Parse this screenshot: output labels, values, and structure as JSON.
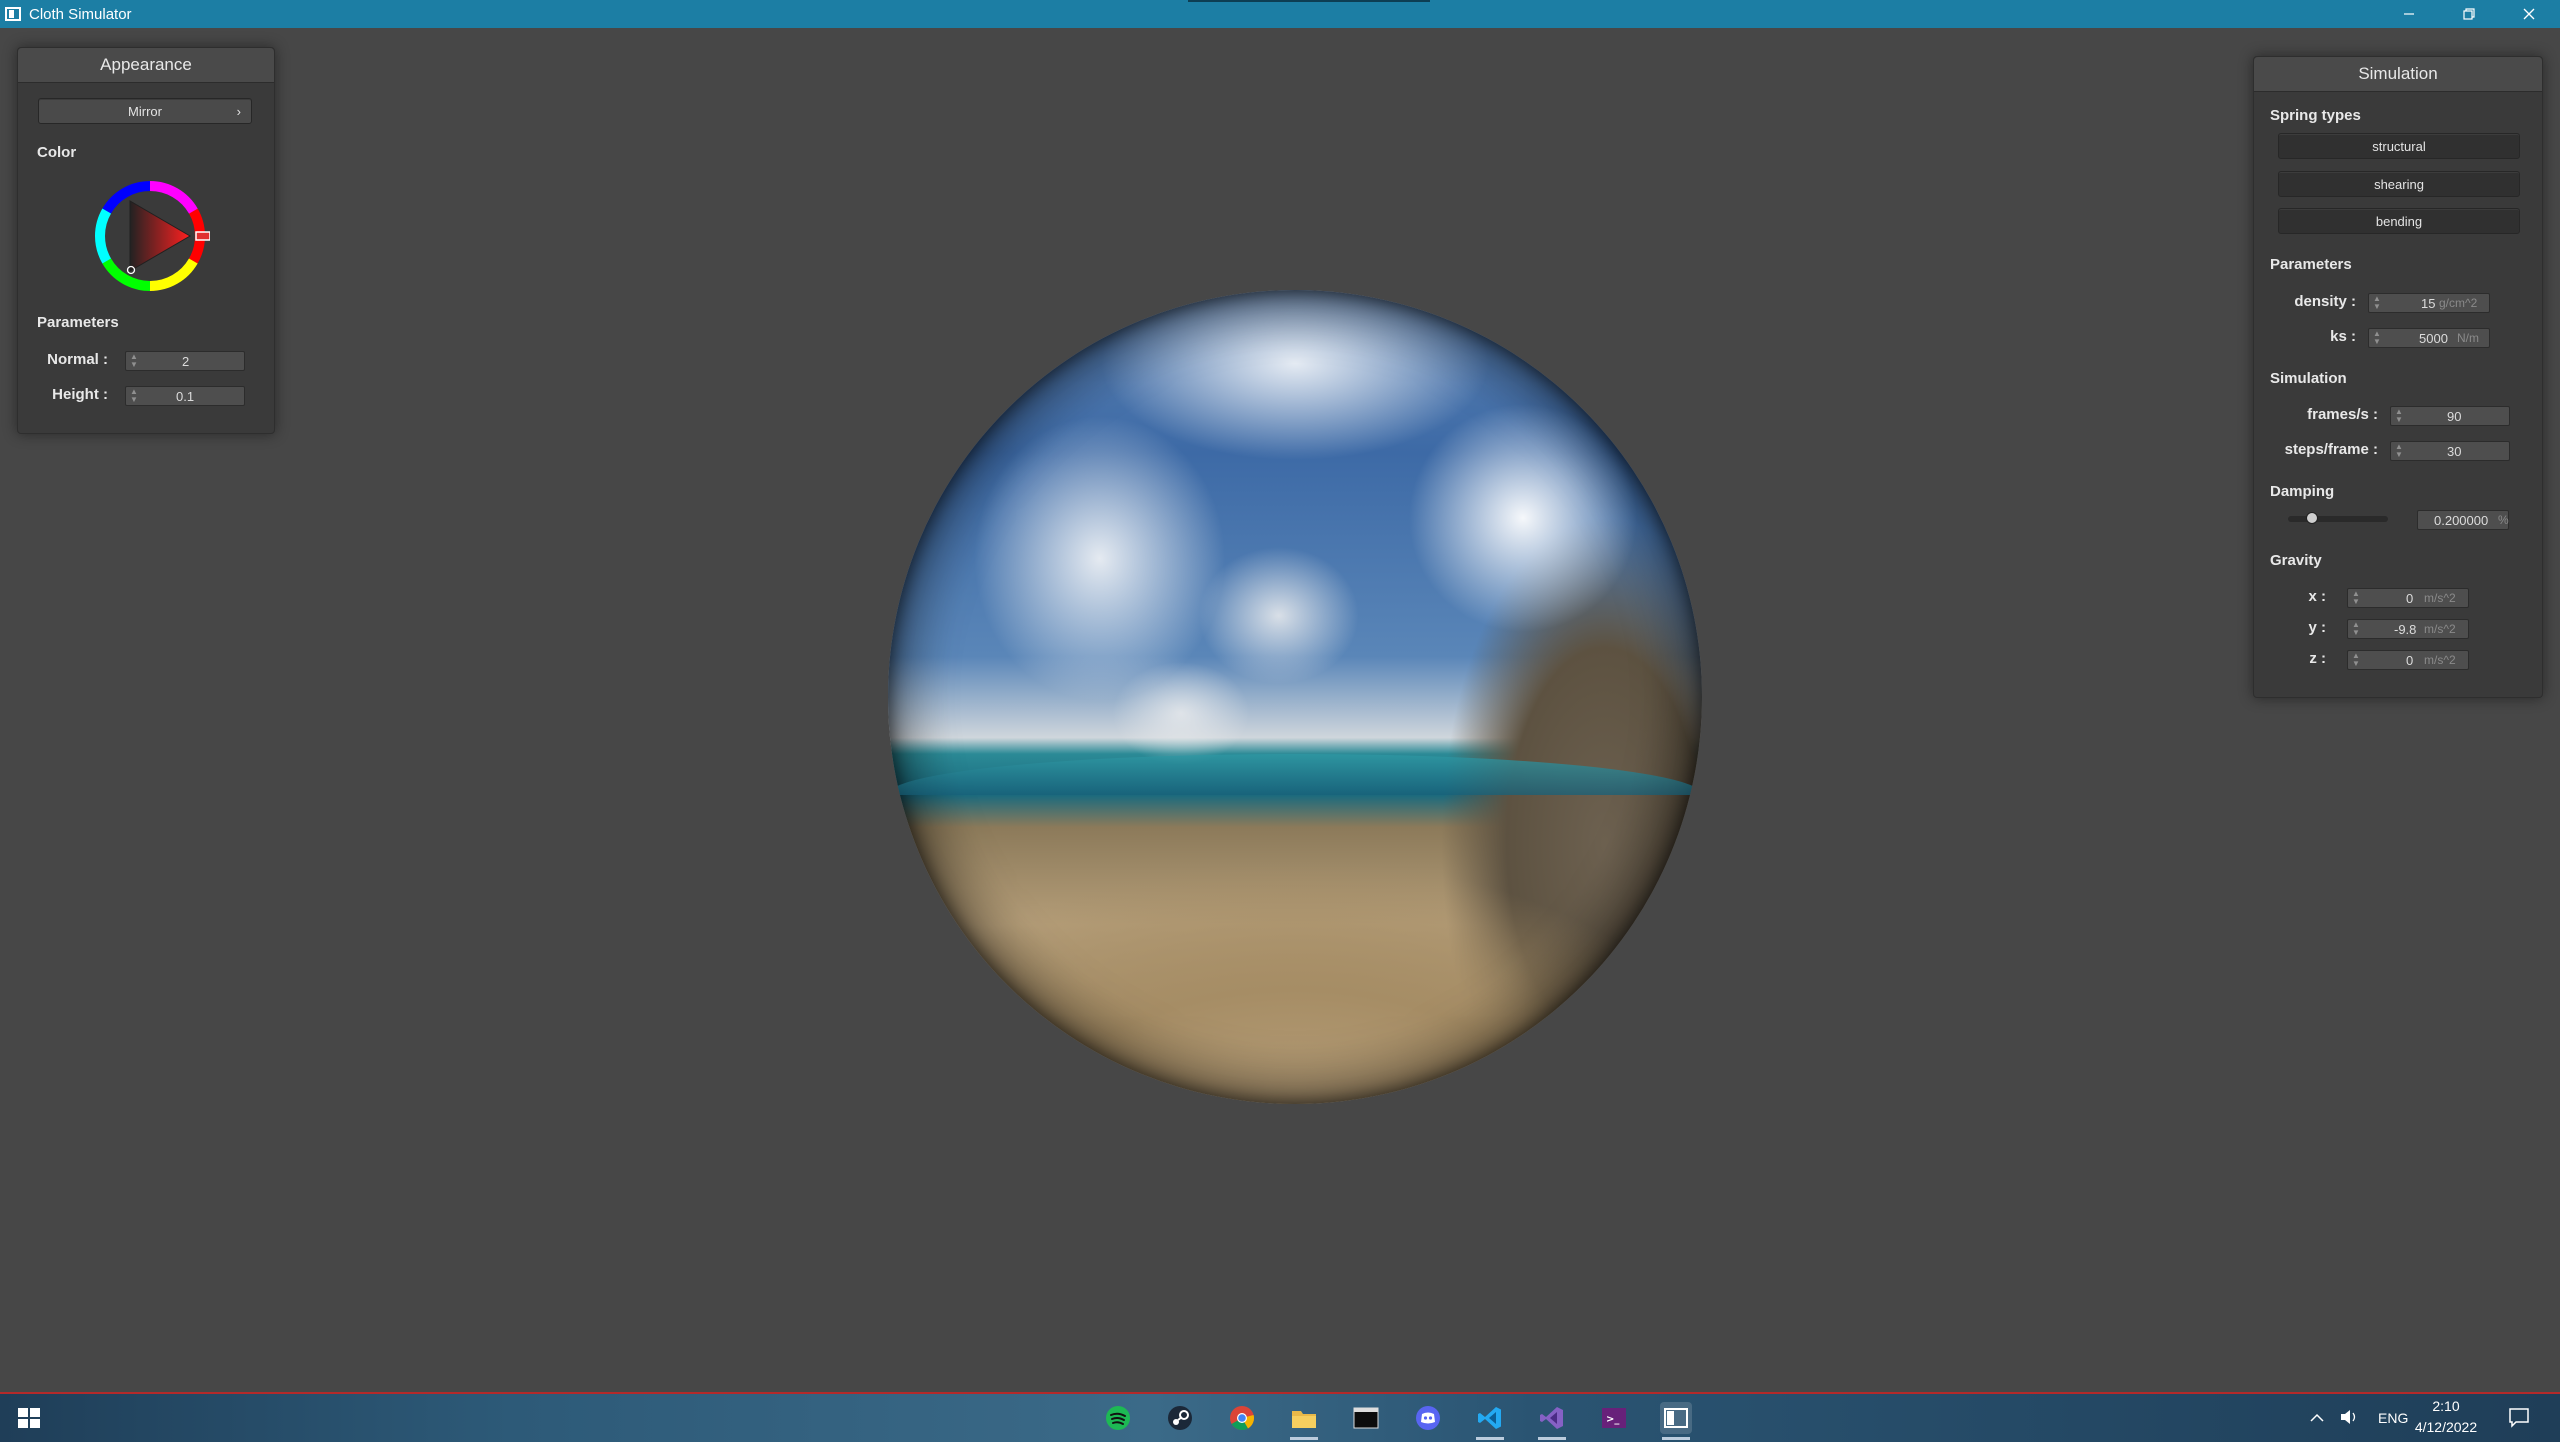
{
  "window": {
    "title": "Cloth Simulator"
  },
  "appearance": {
    "header": "Appearance",
    "material_dropdown": "Mirror",
    "dropdown_arrow": "›",
    "color_label": "Color",
    "parameters_label": "Parameters",
    "normal_label": "Normal :",
    "normal_value": "2",
    "height_label": "Height :",
    "height_value": "0.1"
  },
  "simulation": {
    "header": "Simulation",
    "spring_types_label": "Spring types",
    "spring_buttons": [
      "structural",
      "shearing",
      "bending"
    ],
    "parameters_label": "Parameters",
    "density_label": "density :",
    "density_value": "15",
    "density_unit": "g/cm^2",
    "ks_label": "ks :",
    "ks_value": "5000",
    "ks_unit": "N/m",
    "simulation_label": "Simulation",
    "fps_label": "frames/s :",
    "fps_value": "90",
    "steps_label": "steps/frame :",
    "steps_value": "30",
    "damping_label": "Damping",
    "damping_value": "0.200000",
    "damping_unit": "%",
    "damping_fraction": 0.2,
    "gravity_label": "Gravity",
    "gx_label": "x :",
    "gx_value": "0",
    "gy_label": "y :",
    "gy_value": "-9.8",
    "gz_label": "z :",
    "gz_value": "0",
    "g_unit": "m/s^2"
  },
  "taskbar": {
    "apps": [
      "spotify-icon",
      "steam-icon",
      "chrome-icon",
      "file-explorer-icon",
      "terminal-icon",
      "discord-icon",
      "vscode-icon",
      "visual-studio-icon",
      "visual-studio-preview-icon",
      "cloth-simulator-icon"
    ],
    "language": "ENG",
    "time": "2:10",
    "date": "4/12/2022"
  },
  "colors": {
    "titlebar": "#1c7ea4",
    "background": "#474747",
    "panel": "#3a3a3a",
    "color_picker_selection": "#e03030"
  }
}
